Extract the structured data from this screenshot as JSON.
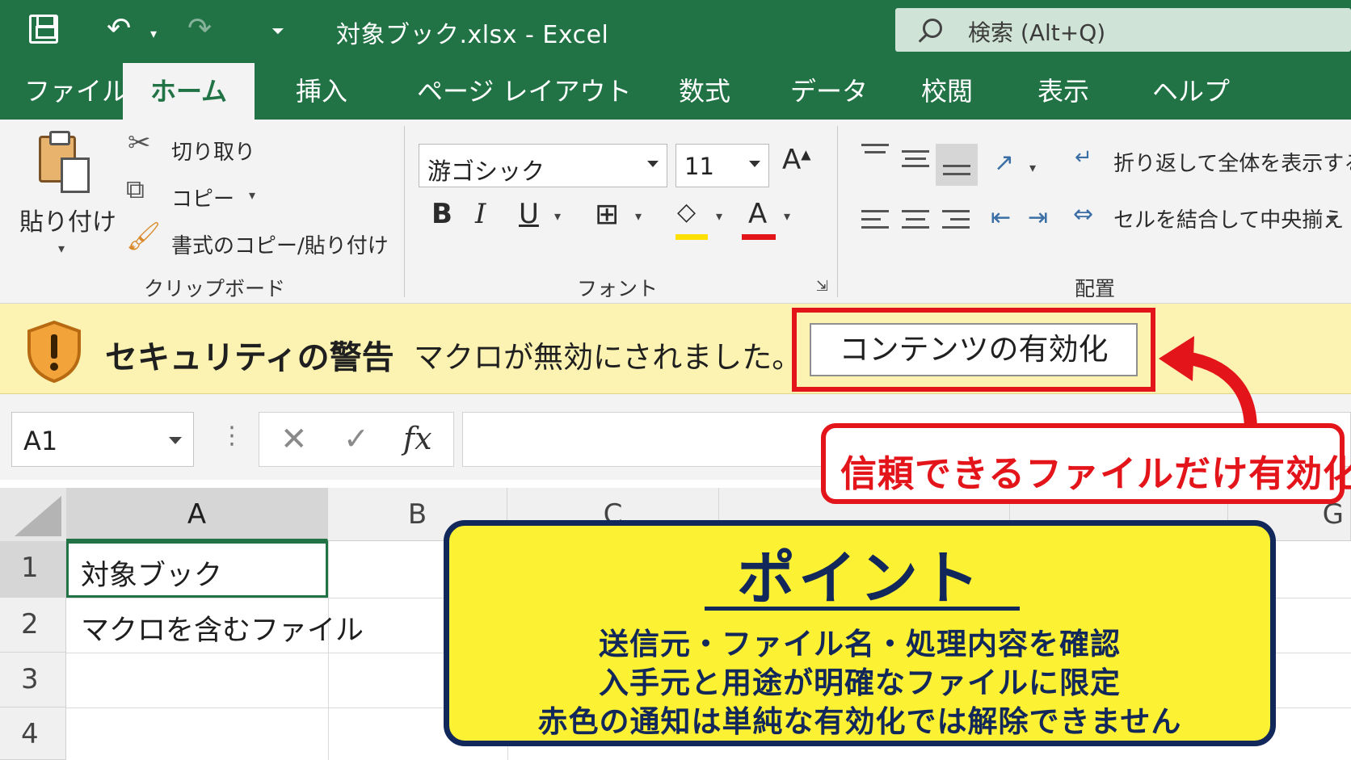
{
  "titlebar": {
    "doc_title": "対象ブック.xlsx  -  Excel",
    "search_placeholder": "検索 (Alt+Q)"
  },
  "tabs": [
    {
      "label": "ファイル",
      "active": false
    },
    {
      "label": "ホーム",
      "active": true
    },
    {
      "label": "挿入",
      "active": false
    },
    {
      "label": "ページ レイアウト",
      "active": false
    },
    {
      "label": "数式",
      "active": false
    },
    {
      "label": "データ",
      "active": false
    },
    {
      "label": "校閲",
      "active": false
    },
    {
      "label": "表示",
      "active": false
    },
    {
      "label": "ヘルプ",
      "active": false
    }
  ],
  "ribbon": {
    "clipboard": {
      "paste_label": "貼り付け",
      "cut_label": "切り取り",
      "copy_label": "コピー",
      "format_painter_label": "書式のコピー/貼り付け",
      "group_label": "クリップボード"
    },
    "font": {
      "font_name": "游ゴシック",
      "font_size": "11",
      "group_label": "フォント",
      "bold": "B",
      "italic": "I",
      "underline": "U",
      "font_color_glyph": "A",
      "highlight_color": "#ffe000",
      "font_color": "#e4141b"
    },
    "alignment": {
      "wrap_label": "折り返して全体を表示する",
      "merge_label": "セルを結合して中央揃え",
      "group_label": "配置"
    }
  },
  "security_bar": {
    "title": "セキュリティの警告",
    "message": "マクロが無効にされました。",
    "button_label": "コンテンツの有効化"
  },
  "formula_bar": {
    "name_box": "A1",
    "fx": "fx",
    "formula": ""
  },
  "sheet": {
    "columns": [
      "A",
      "B",
      "C",
      "",
      "",
      "G"
    ],
    "rows": [
      "1",
      "2",
      "3",
      "4"
    ],
    "cells": {
      "A1": "対象ブック",
      "A2": "マクロを含むファイル"
    }
  },
  "callouts": {
    "trust_note": "信頼できるファイルだけ有効化",
    "point_title": "ポイント",
    "point_lines": [
      "送信元・ファイル名・処理内容を確認",
      "入手元と用途が明確なファイルに限定",
      "赤色の通知は単純な有効化では解除できません"
    ]
  },
  "colors": {
    "excel_green": "#217346",
    "security_bar": "#fcf3b2",
    "alert_red": "#e4141b",
    "point_yellow": "#fdf133",
    "point_navy": "#12275a"
  }
}
